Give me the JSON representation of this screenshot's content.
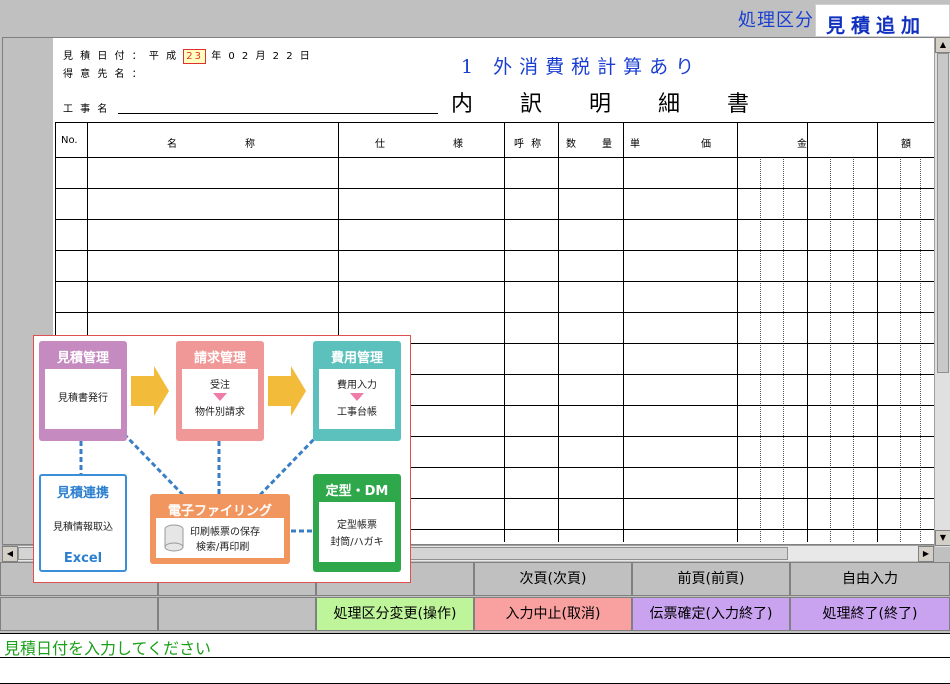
{
  "mode": {
    "label": "処理区分",
    "value": "見積追加"
  },
  "header": {
    "date_label": "見 積 日 付 ：",
    "era": "平 成",
    "era_year": "23",
    "year_suffix": "年",
    "month_day": "0 2 月 2 2 日",
    "customer_label": "得 意 先 名 ：",
    "tax_note": "1 外消費税計算あり",
    "title": "内 訳 明 細 書",
    "project_label": "工 事 名"
  },
  "table": {
    "columns": [
      "No.",
      "名",
      "称",
      "仕",
      "様",
      "呼 称",
      "数",
      "量",
      "単",
      "価",
      "金",
      "額"
    ],
    "row_count": 12
  },
  "overlay": {
    "estimate": {
      "title": "見積管理",
      "body": "見積書発行"
    },
    "billing": {
      "title": "請求管理",
      "line1": "受注",
      "line2": "物件別請求"
    },
    "cost": {
      "title": "費用管理",
      "line1": "費用入力",
      "line2": "工事台帳"
    },
    "link": {
      "title": "見積連携",
      "body": "見積情報取込",
      "excel": "Excel"
    },
    "filing": {
      "title": "電子ファイリング",
      "line1": "印刷帳票の保存",
      "line2": "検索/再印刷"
    },
    "dm": {
      "title": "定型・DM",
      "line1": "定型帳票",
      "line2": "封筒/ハガキ"
    }
  },
  "fkeys": {
    "row1": [
      "",
      "",
      "",
      "次頁(次頁)",
      "前頁(前頁)",
      "自由入力"
    ],
    "row2": [
      "",
      "",
      "処理区分変更(操作)",
      "入力中止(取消)",
      "伝票確定(入力終了)",
      "処理終了(終了)"
    ]
  },
  "colors": {
    "fk_green": "#bff59a",
    "fk_red": "#f9a0a0",
    "fk_purple": "#c9a3f0"
  },
  "status": {
    "message": "見積日付を入力してください"
  }
}
